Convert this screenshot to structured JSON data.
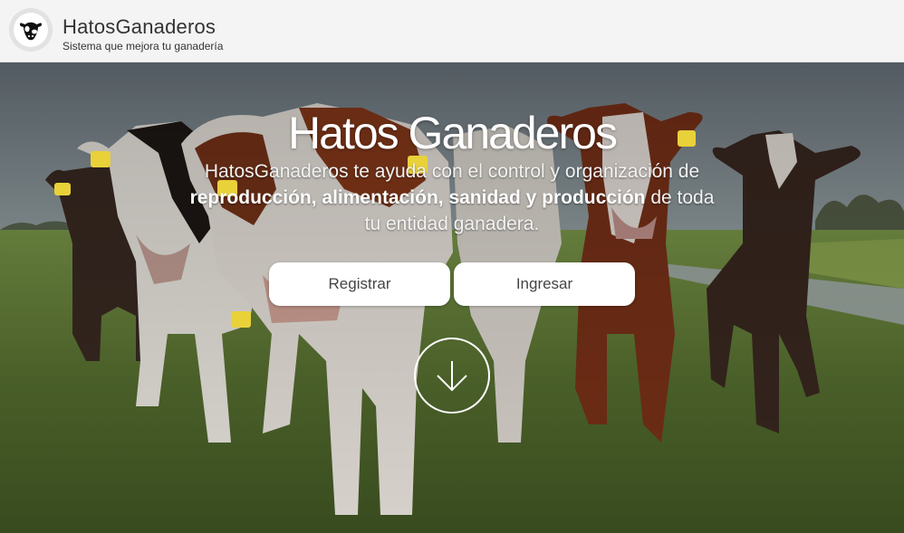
{
  "header": {
    "brand_title": "HatosGanaderos",
    "brand_subtitle": "Sistema que mejora tu ganadería",
    "logo_icon": "cow-logo-icon"
  },
  "hero": {
    "title": "Hatos Ganaderos",
    "intro": "HatosGanaderos te ayuda con el control y organización de",
    "highlight": "reproducción, alimentación, sanidad y producción",
    "outro": "de toda tu entidad ganadera.",
    "buttons": {
      "register": "Registrar",
      "login": "Ingresar"
    },
    "scroll_icon": "arrow-down-circle-icon",
    "background": "photo of calves in a green pasture"
  },
  "colors": {
    "header_bg": "#f4f4f5",
    "button_bg": "#ffffff",
    "text_light": "#ffffff"
  }
}
